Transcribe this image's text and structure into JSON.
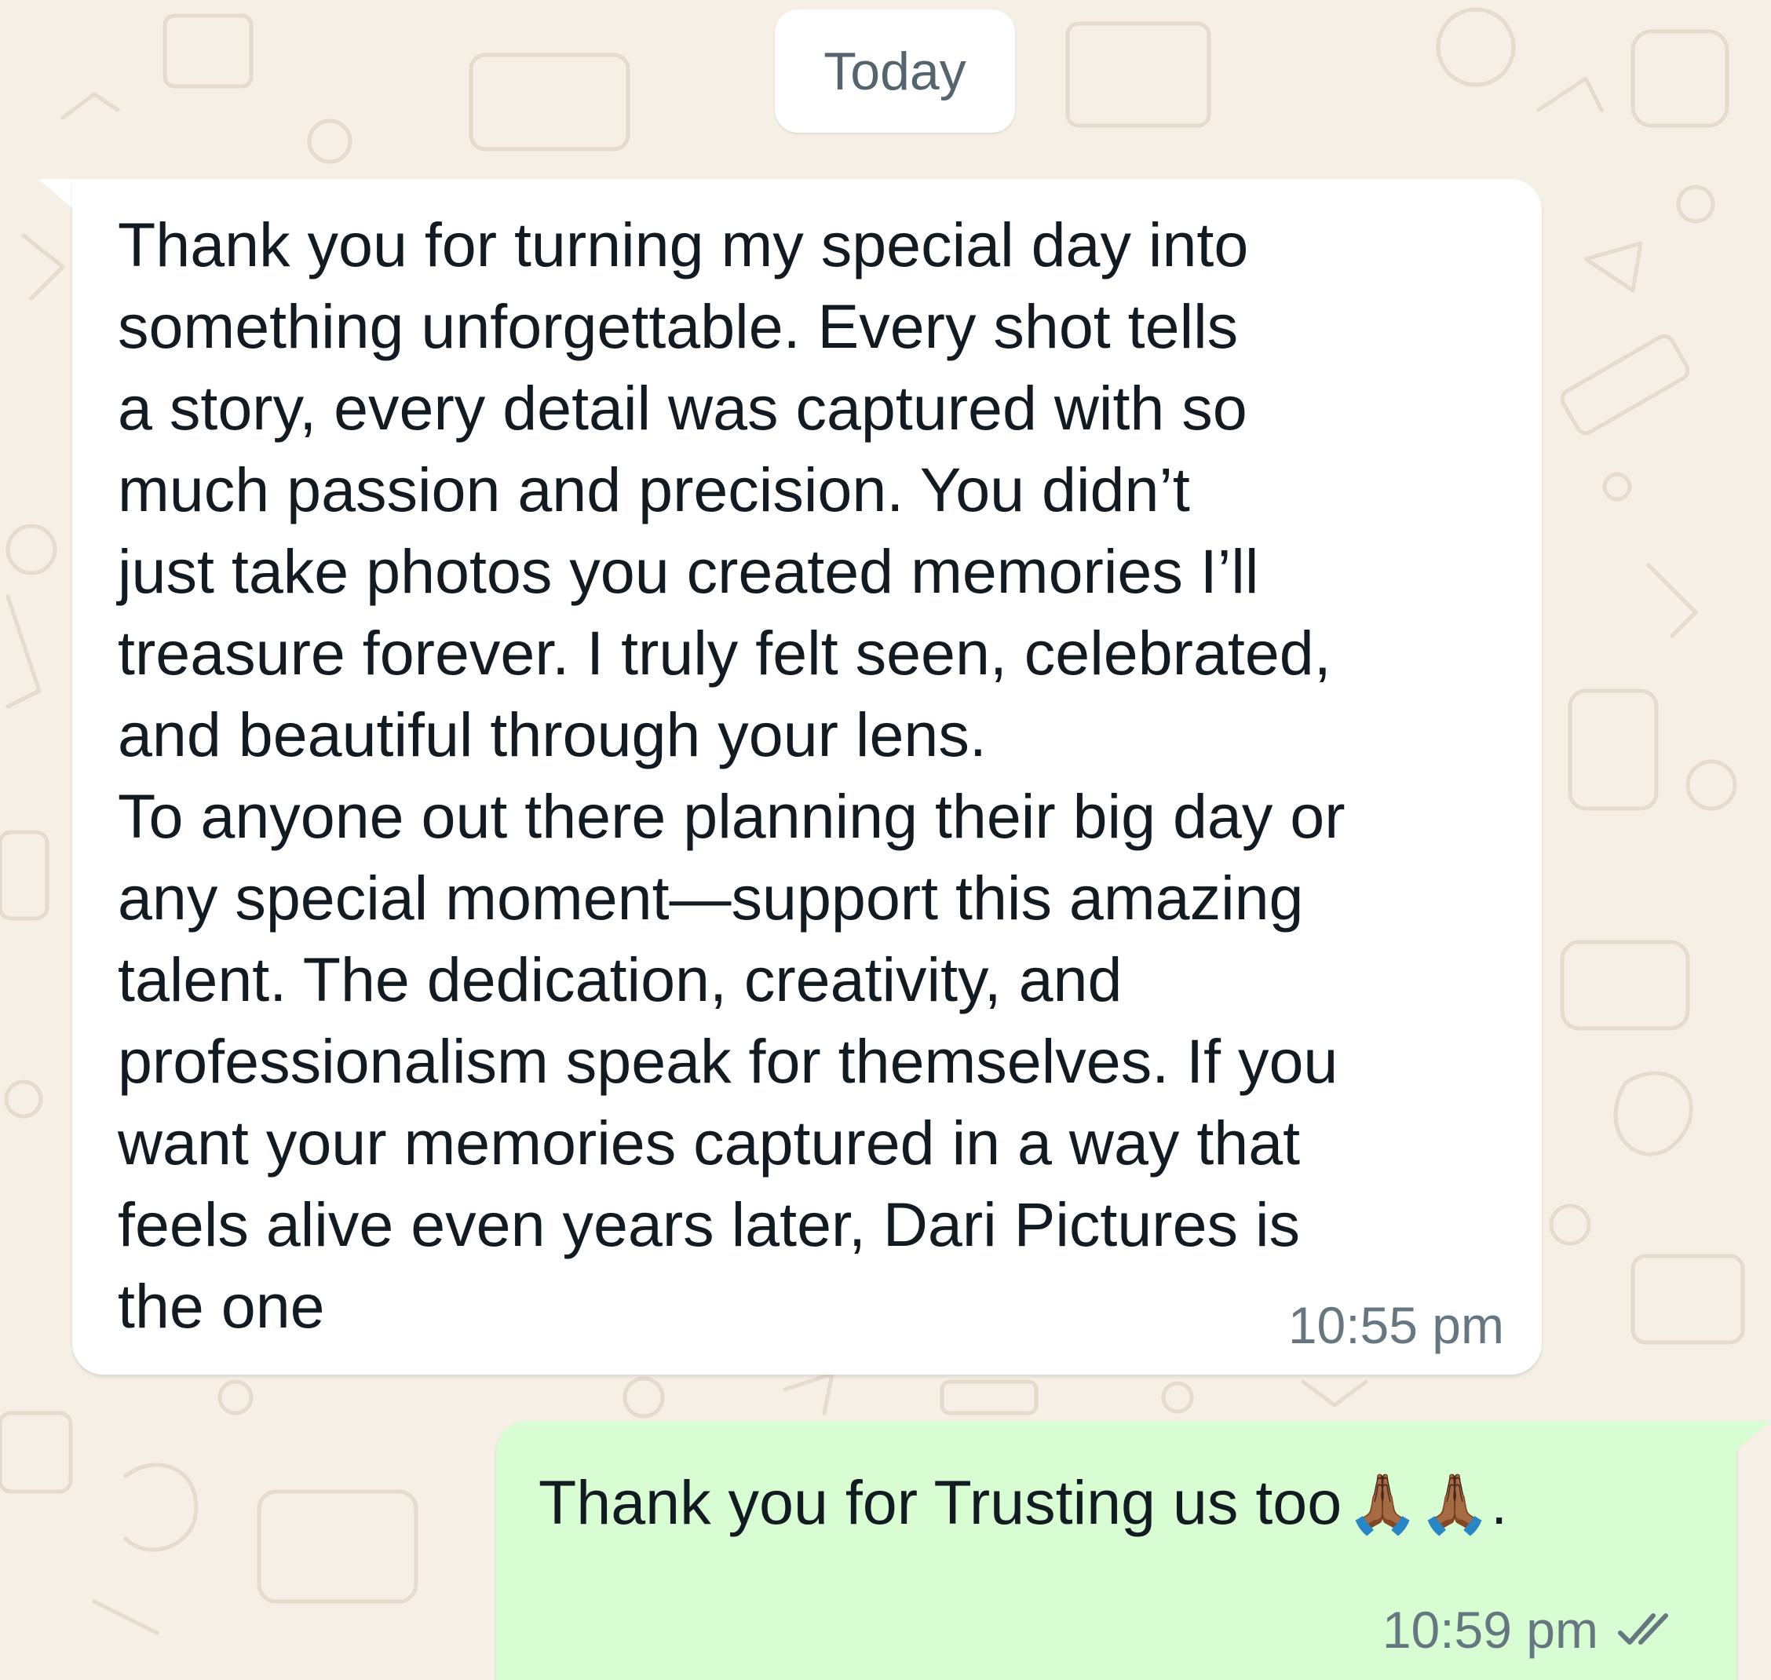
{
  "date_separator": {
    "label": "Today"
  },
  "messages": [
    {
      "direction": "incoming",
      "text": "Thank you for turning my special day into\nsomething unforgettable. Every shot tells\na story, every detail was captured with so\nmuch passion and precision. You didn’t\njust take photos you created memories I’ll\ntreasure forever. I truly felt seen, celebrated,\nand beautiful through your lens.\nTo anyone out there planning their big day or\nany special moment—support this amazing\ntalent. The dedication, creativity, and\nprofessionalism speak for themselves. If you\nwant your memories captured in a way that\nfeels alive even years later, Dari Pictures is\nthe one",
      "time": "10:55 pm"
    },
    {
      "direction": "outgoing",
      "text": "Thank you for Trusting us too",
      "emoji": "🙏🏾🙏🏾.",
      "time": "10:59 pm",
      "status_icon": "double-check-icon"
    }
  ],
  "colors": {
    "wallpaper": "#f5efe6",
    "incoming_bubble": "#ffffff",
    "outgoing_bubble": "#d9fdd3",
    "timestamp": "#667781"
  }
}
